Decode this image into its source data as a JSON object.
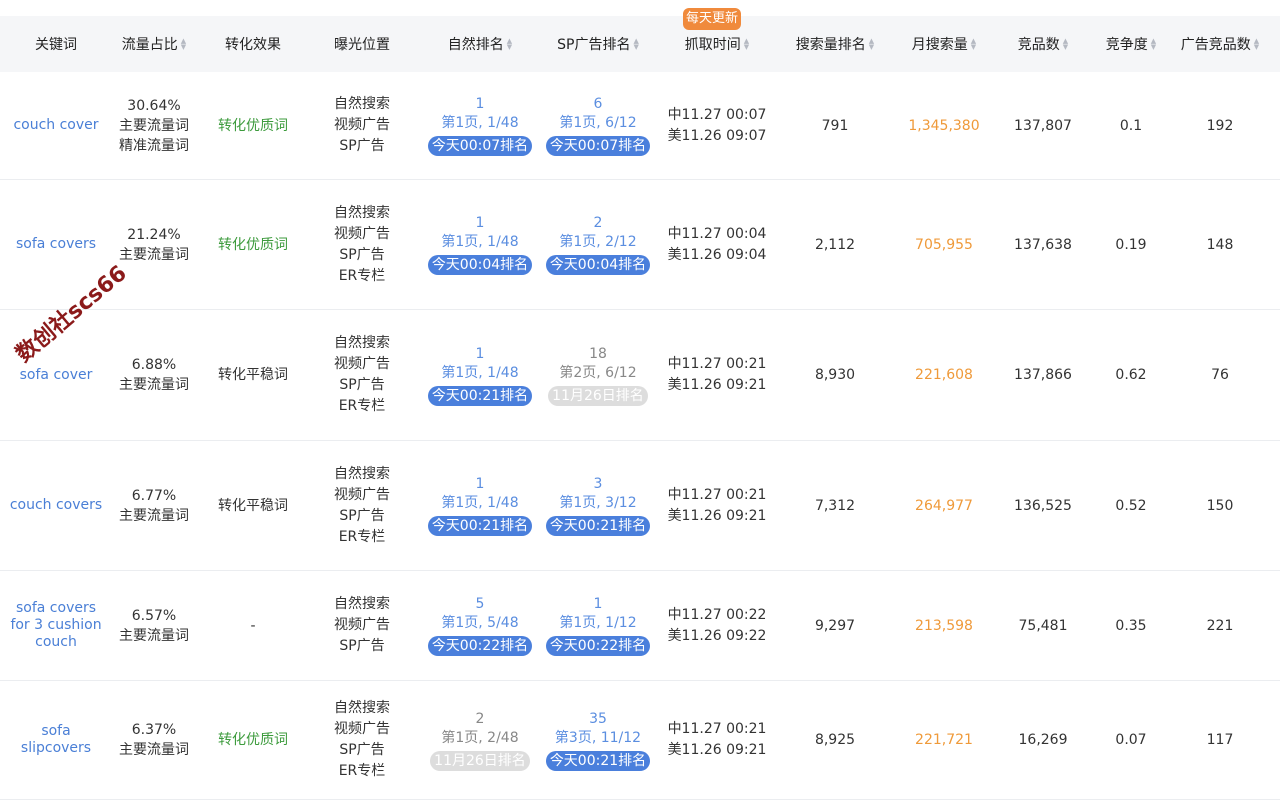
{
  "badge": "每天更新",
  "headers": [
    {
      "label": "关键词",
      "sortable": false
    },
    {
      "label": "流量占比",
      "sortable": true
    },
    {
      "label": "转化效果",
      "sortable": false
    },
    {
      "label": "曝光位置",
      "sortable": false
    },
    {
      "label": "自然排名",
      "sortable": true
    },
    {
      "label": "SP广告排名",
      "sortable": true
    },
    {
      "label": "抓取时间",
      "sortable": true
    },
    {
      "label": "搜索量排名",
      "sortable": true
    },
    {
      "label": "月搜索量",
      "sortable": true
    },
    {
      "label": "竞品数",
      "sortable": true
    },
    {
      "label": "竞争度",
      "sortable": true
    },
    {
      "label": "广告竞品数",
      "sortable": true
    }
  ],
  "rows": [
    {
      "keyword": [
        "couch cover"
      ],
      "traffic": [
        "30.64%",
        "主要流量词",
        "精准流量词"
      ],
      "conversion": "转化优质词",
      "conversion_good": true,
      "exposure": [
        "自然搜索",
        "视频广告",
        "SP广告"
      ],
      "natural": {
        "rank": "1",
        "page": "第1页, 1/48",
        "pill": "今天00:07排名",
        "today": true
      },
      "sp": {
        "rank": "6",
        "page": "第1页, 6/12",
        "pill": "今天00:07排名",
        "today": true
      },
      "time": [
        "中11.27 00:07",
        "美11.26 09:07"
      ],
      "search_rank": "791",
      "monthly": "1,345,380",
      "competitors": "137,807",
      "competition": "0.1",
      "ad_competitors": "192"
    },
    {
      "keyword": [
        "sofa covers"
      ],
      "traffic": [
        "21.24%",
        "主要流量词"
      ],
      "conversion": "转化优质词",
      "conversion_good": true,
      "exposure": [
        "自然搜索",
        "视频广告",
        "SP广告",
        "ER专栏"
      ],
      "natural": {
        "rank": "1",
        "page": "第1页, 1/48",
        "pill": "今天00:04排名",
        "today": true
      },
      "sp": {
        "rank": "2",
        "page": "第1页, 2/12",
        "pill": "今天00:04排名",
        "today": true
      },
      "time": [
        "中11.27 00:04",
        "美11.26 09:04"
      ],
      "search_rank": "2,112",
      "monthly": "705,955",
      "competitors": "137,638",
      "competition": "0.19",
      "ad_competitors": "148"
    },
    {
      "keyword": [
        "sofa cover"
      ],
      "traffic": [
        "6.88%",
        "主要流量词"
      ],
      "conversion": "转化平稳词",
      "conversion_good": false,
      "exposure": [
        "自然搜索",
        "视频广告",
        "SP广告",
        "ER专栏"
      ],
      "natural": {
        "rank": "1",
        "page": "第1页, 1/48",
        "pill": "今天00:21排名",
        "today": true
      },
      "sp": {
        "rank": "18",
        "page": "第2页, 6/12",
        "pill": "11月26日排名",
        "today": false
      },
      "time": [
        "中11.27 00:21",
        "美11.26 09:21"
      ],
      "search_rank": "8,930",
      "monthly": "221,608",
      "competitors": "137,866",
      "competition": "0.62",
      "ad_competitors": "76"
    },
    {
      "keyword": [
        "couch covers"
      ],
      "traffic": [
        "6.77%",
        "主要流量词"
      ],
      "conversion": "转化平稳词",
      "conversion_good": false,
      "exposure": [
        "自然搜索",
        "视频广告",
        "SP广告",
        "ER专栏"
      ],
      "natural": {
        "rank": "1",
        "page": "第1页, 1/48",
        "pill": "今天00:21排名",
        "today": true
      },
      "sp": {
        "rank": "3",
        "page": "第1页, 3/12",
        "pill": "今天00:21排名",
        "today": true
      },
      "time": [
        "中11.27 00:21",
        "美11.26 09:21"
      ],
      "search_rank": "7,312",
      "monthly": "264,977",
      "competitors": "136,525",
      "competition": "0.52",
      "ad_competitors": "150"
    },
    {
      "keyword": [
        "sofa covers",
        "for 3 cushion",
        "couch"
      ],
      "traffic": [
        "6.57%",
        "主要流量词"
      ],
      "conversion": "-",
      "conversion_good": false,
      "exposure": [
        "自然搜索",
        "视频广告",
        "SP广告"
      ],
      "natural": {
        "rank": "5",
        "page": "第1页, 5/48",
        "pill": "今天00:22排名",
        "today": true
      },
      "sp": {
        "rank": "1",
        "page": "第1页, 1/12",
        "pill": "今天00:22排名",
        "today": true
      },
      "time": [
        "中11.27 00:22",
        "美11.26 09:22"
      ],
      "search_rank": "9,297",
      "monthly": "213,598",
      "competitors": "75,481",
      "competition": "0.35",
      "ad_competitors": "221"
    },
    {
      "keyword": [
        "sofa",
        "slipcovers"
      ],
      "traffic": [
        "6.37%",
        "主要流量词"
      ],
      "conversion": "转化优质词",
      "conversion_good": true,
      "exposure": [
        "自然搜索",
        "视频广告",
        "SP广告",
        "ER专栏"
      ],
      "natural": {
        "rank": "2",
        "page": "第1页, 2/48",
        "pill": "11月26日排名",
        "today": false
      },
      "sp": {
        "rank": "35",
        "page": "第3页, 11/12",
        "pill": "今天00:21排名",
        "today": true
      },
      "time": [
        "中11.27 00:21",
        "美11.26 09:21"
      ],
      "search_rank": "8,925",
      "monthly": "221,721",
      "competitors": "16,269",
      "competition": "0.07",
      "ad_competitors": "117"
    }
  ],
  "watermark": "数创社scs66"
}
